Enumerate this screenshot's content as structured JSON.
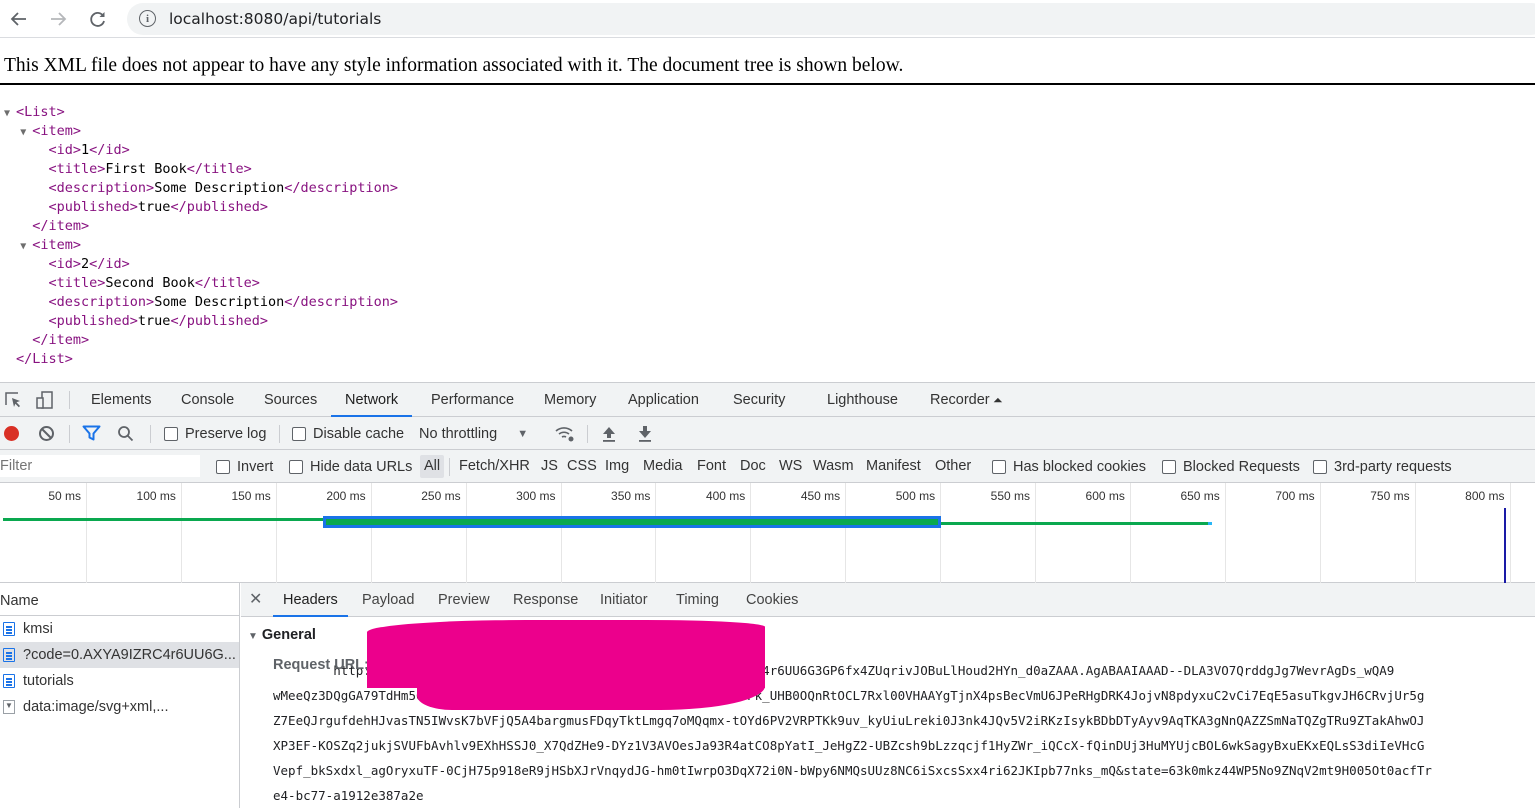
{
  "browser": {
    "url": "localhost:8080/api/tutorials",
    "back_icon": "arrow-left-icon",
    "forward_icon": "arrow-right-icon",
    "reload_icon": "reload-icon",
    "info_icon": "info-icon"
  },
  "xml_viewer": {
    "info_message": "This XML file does not appear to have any style information associated with it. The document tree is shown below.",
    "lines": [
      {
        "indent": 0,
        "fold": true,
        "open": "<List>",
        "text": "",
        "close": ""
      },
      {
        "indent": 1,
        "fold": true,
        "open": "<item>",
        "text": "",
        "close": ""
      },
      {
        "indent": 2,
        "fold": false,
        "open": "<id>",
        "text": "1",
        "close": "</id>"
      },
      {
        "indent": 2,
        "fold": false,
        "open": "<title>",
        "text": "First Book",
        "close": "</title>"
      },
      {
        "indent": 2,
        "fold": false,
        "open": "<description>",
        "text": "Some Description",
        "close": "</description>"
      },
      {
        "indent": 2,
        "fold": false,
        "open": "<published>",
        "text": "true",
        "close": "</published>"
      },
      {
        "indent": 1,
        "fold": false,
        "open": "</item>",
        "text": "",
        "close": ""
      },
      {
        "indent": 1,
        "fold": true,
        "open": "<item>",
        "text": "",
        "close": ""
      },
      {
        "indent": 2,
        "fold": false,
        "open": "<id>",
        "text": "2",
        "close": "</id>"
      },
      {
        "indent": 2,
        "fold": false,
        "open": "<title>",
        "text": "Second Book",
        "close": "</title>"
      },
      {
        "indent": 2,
        "fold": false,
        "open": "<description>",
        "text": "Some Description",
        "close": "</description>"
      },
      {
        "indent": 2,
        "fold": false,
        "open": "<published>",
        "text": "true",
        "close": "</published>"
      },
      {
        "indent": 1,
        "fold": false,
        "open": "</item>",
        "text": "",
        "close": ""
      },
      {
        "indent": 0,
        "fold": false,
        "open": "</List>",
        "text": "",
        "close": ""
      }
    ]
  },
  "devtools": {
    "tabs": [
      "Elements",
      "Console",
      "Sources",
      "Network",
      "Performance",
      "Memory",
      "Application",
      "Security",
      "Lighthouse",
      "Recorder"
    ],
    "active_tab": "Network",
    "toolbar": {
      "preserve_log": "Preserve log",
      "disable_cache": "Disable cache",
      "throttling": "No throttling"
    },
    "filter": {
      "placeholder": "Filter",
      "invert": "Invert",
      "hide_data_urls": "Hide data URLs",
      "types": [
        "All",
        "Fetch/XHR",
        "JS",
        "CSS",
        "Img",
        "Media",
        "Font",
        "Doc",
        "WS",
        "Wasm",
        "Manifest",
        "Other"
      ],
      "active_type": "All",
      "has_blocked_cookies": "Has blocked cookies",
      "blocked_requests": "Blocked Requests",
      "third_party": "3rd-party requests"
    },
    "timeline": {
      "ticks": [
        "50 ms",
        "100 ms",
        "150 ms",
        "200 ms",
        "250 ms",
        "300 ms",
        "350 ms",
        "400 ms",
        "450 ms",
        "500 ms",
        "550 ms",
        "600 ms",
        "650 ms",
        "700 ms",
        "750 ms",
        "800 ms"
      ],
      "colors": {
        "waiting": "#0aa84f",
        "selected": "#1a73e8",
        "marker": "#1a1aa6"
      }
    },
    "requests": {
      "header": "Name",
      "items": [
        {
          "name": "kmsi",
          "type": "document",
          "selected": false
        },
        {
          "name": "?code=0.AXYA9IZRC4r6UU6G...",
          "type": "document",
          "selected": true
        },
        {
          "name": "tutorials",
          "type": "document",
          "selected": false
        },
        {
          "name": "data:image/svg+xml,...",
          "type": "image",
          "selected": false
        }
      ]
    },
    "details": {
      "tabs": [
        "Headers",
        "Payload",
        "Preview",
        "Response",
        "Initiator",
        "Timing",
        "Cookies"
      ],
      "active_tab": "Headers",
      "section": "General",
      "request_url_label": "Request URL:",
      "request_url_lines": [
        "        http://localhost:8080/login/oauth2/code/?code=0.AXYA9IZRC4r6UU6G3GP6fx4ZUqrivJOBuLlHoud2HYn_d0aZAAA.AgABAAIAAAD--DLA3VO7QrddgJg7WevrAgDs_wQA9",
        "wMeeQz3DQgGA79TdHm509YXShJb6RL2fkHmAuBYsvC0v7Y1yM9SyaQMr4hoZY6sPk_UHB0OQnRtOCL7Rxl00VHAAYgTjnX4psBecVmU6JPeRHgDRK4JojvN8pdyxuC2vCi7EqE5asuTkgvJH6CRvjUr5g",
        "Z7EeQJrgufdehHJvasTN5IWvsK7bVFjQ5A4bargmusFDqyTktLmgq7oMQqmx-tOYd6PV2VRPTKk9uv_kyUiuLreki0J3nk4JQv5V2iRKzIsykBDbDTyAyv9AqTKA3gNnQAZZSmNaTQZgTRu9ZTakAhwOJ",
        "XP3EF-KOSZq2jukjSVUFbAvhlv9EXhHSSJ0_X7QdZHe9-DYz1V3AVOesJa93R4atCO8pYatI_JeHgZ2-UBZcsh9bLzzqcjf1HyZWr_iQCcX-fQinDUj3HuMYUjcBOL6wkSagyBxuEKxEQLsS3diIeVHcG",
        "Vepf_bkSxdxl_agOryxuTF-0CjH75p918eR9jHSbXJrVnqydJG-hm0tIwrpO3DqX72i0N-bWpy6NMQsUUz8NC6iSxcsSxx4ri62JKIpb77nks_mQ&state=63k0mkz44WP5No9ZNqV2mt9H005Ot0acfTr",
        "e4-bc77-a1912e387a2e"
      ]
    }
  }
}
